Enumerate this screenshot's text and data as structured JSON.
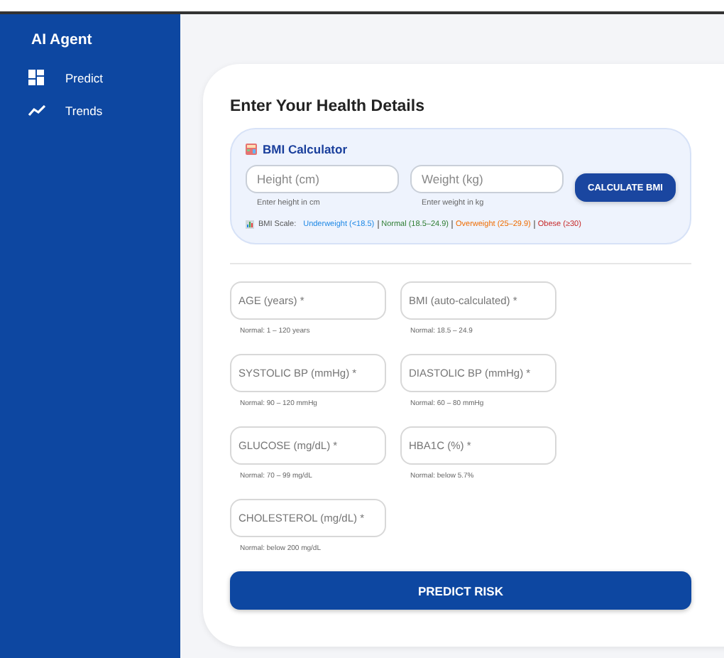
{
  "sidebar": {
    "title": "AI Agent",
    "items": [
      {
        "label": "Predict",
        "kind": "grid"
      },
      {
        "label": "Trends",
        "kind": "trend"
      }
    ]
  },
  "form": {
    "title": "Enter Your Health Details",
    "bmi": {
      "title": "BMI Calculator",
      "inputs": [
        {
          "placeholder": "Height (cm)",
          "hint": "Enter height in cm"
        },
        {
          "placeholder": "Weight (kg)",
          "hint": "Enter weight in kg"
        }
      ],
      "button": "CALCULATE BMI",
      "scale": {
        "label": "BMI Scale:",
        "ranges": [
          {
            "text": "Underweight (<18.5)",
            "color": "#1e88e5"
          },
          {
            "text": "Normal (18.5–24.9)",
            "color": "#2e7d32"
          },
          {
            "text": "Overweight (25–29.9)",
            "color": "#ef6c00"
          },
          {
            "text": "Obese (≥30)",
            "color": "#c62828"
          }
        ]
      }
    },
    "fields": [
      {
        "placeholder": "AGE (years) *",
        "hint": "Normal: 1 – 120 years"
      },
      {
        "placeholder": "BMI (auto-calculated) *",
        "hint": "Normal: 18.5 – 24.9"
      },
      {
        "placeholder": "SYSTOLIC BP (mmHg) *",
        "hint": "Normal: 90 – 120 mmHg"
      },
      {
        "placeholder": "DIASTOLIC BP (mmHg) *",
        "hint": "Normal: 60 – 80 mmHg"
      },
      {
        "placeholder": "GLUCOSE (mg/dL) *",
        "hint": "Normal: 70 – 99 mg/dL"
      },
      {
        "placeholder": "HBA1C (%) *",
        "hint": "Normal: below 5.7%"
      },
      {
        "placeholder": "CHOLESTEROL (mg/dL) *",
        "hint": "Normal: below 200 mg/dL"
      }
    ],
    "submit": "PREDICT RISK"
  }
}
